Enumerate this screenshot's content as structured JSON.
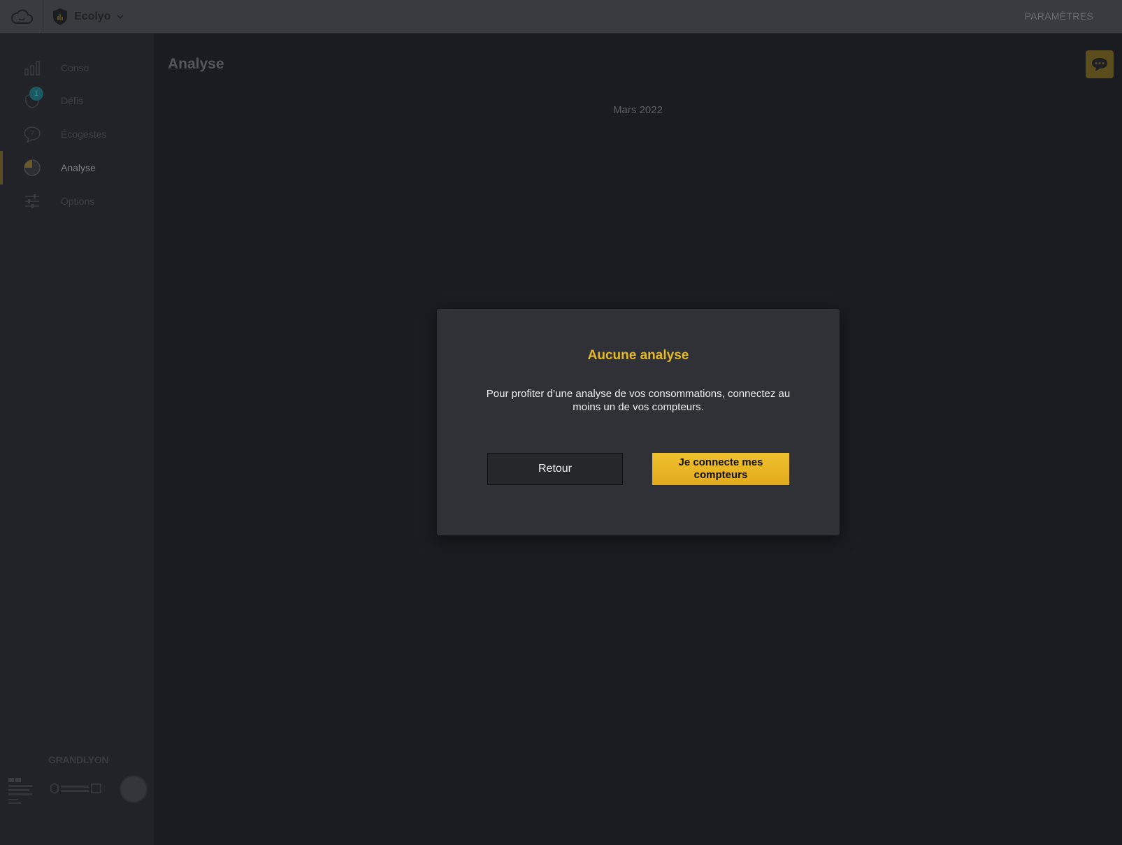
{
  "header": {
    "app_name": "Ecolyo",
    "settings_label": "PARAMÈTRES"
  },
  "sidebar": {
    "items": [
      {
        "label": "Conso",
        "icon": "bar-chart-icon"
      },
      {
        "label": "Défis",
        "icon": "challenge-shield-icon",
        "badge": "1"
      },
      {
        "label": "Écogestes",
        "icon": "question-bubble-icon"
      },
      {
        "label": "Analyse",
        "icon": "pie-chart-icon",
        "active": true
      },
      {
        "label": "Options",
        "icon": "sliders-icon"
      }
    ],
    "footer": {
      "grandlyon": "GRANDLYON"
    }
  },
  "main": {
    "title": "Analyse",
    "period": "Mars 2022"
  },
  "modal": {
    "title": "Aucune analyse",
    "text": "Pour profiter d’une analyse de vos consommations, connectez au moins un de vos compteurs.",
    "back_label": "Retour",
    "connect_label": "Je connecte mes compteurs"
  },
  "colors": {
    "accent": "#e3b82a",
    "overlay_bg": "#1b1c21",
    "modal_bg": "#303136"
  }
}
